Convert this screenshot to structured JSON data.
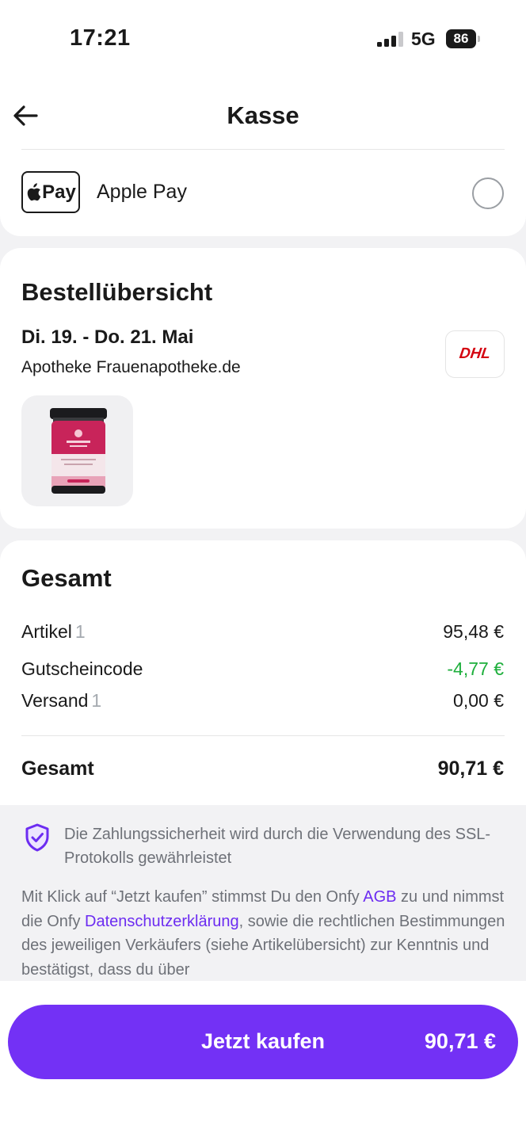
{
  "status_bar": {
    "time": "17:21",
    "network": "5G",
    "battery": "86"
  },
  "header": {
    "title": "Kasse",
    "back_icon": "arrow-left-icon"
  },
  "payment": {
    "logo_text": "Pay",
    "label": "Apple Pay",
    "selected": false
  },
  "order": {
    "title": "Bestellübersicht",
    "delivery_date": "Di. 19. - Do. 21. Mai",
    "seller": "Apotheke Frauenapotheke.de",
    "carrier_logo": "DHL"
  },
  "totals": {
    "title": "Gesamt",
    "rows": [
      {
        "label": "Artikel",
        "count": "1",
        "value": "95,48 €"
      },
      {
        "label": "Gutscheincode",
        "count": "",
        "value": "-4,77 €"
      },
      {
        "label": "Versand",
        "count": "1",
        "value": "0,00 €"
      }
    ],
    "grand_label": "Gesamt",
    "grand_value": "90,71 €"
  },
  "legal": {
    "ssl_text": "Die Zahlungssicherheit wird durch die Verwendung des SSL-Protokolls gewährleistet",
    "consent_1": "Mit Klick auf “Jetzt kaufen” stimmst Du den Onfy ",
    "agb_link": "AGB",
    "consent_2": " zu und nimmst die Onfy ",
    "privacy_link": "Datenschutzerklärung",
    "consent_3": ", sowie die rechtlichen Bestimmungen des jeweiligen Verkäufers (siehe Artikelübersicht) zur Kenntnis und bestätigst, dass du über"
  },
  "cta": {
    "label": "Jetzt kaufen",
    "amount": "90,71 €"
  },
  "colors": {
    "accent": "#7331f5",
    "link": "#6c2cf1",
    "discount": "#1eaf3c",
    "dhl": "#d40511"
  }
}
